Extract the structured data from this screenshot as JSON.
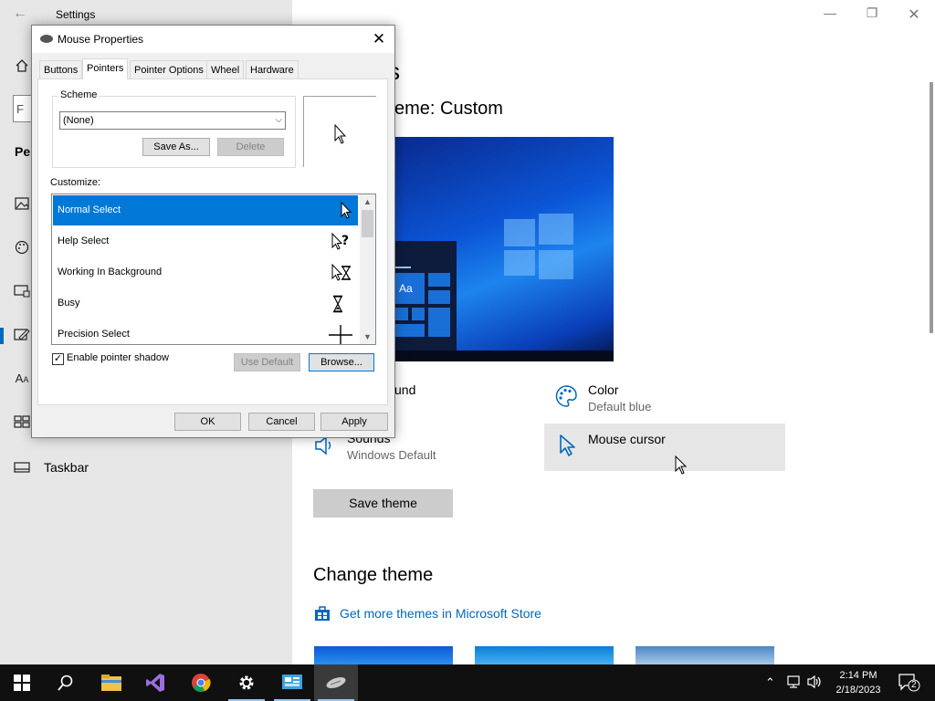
{
  "settings": {
    "title": "Settings",
    "back_icon": "back-arrow-icon",
    "window_controls": [
      "minimize-icon",
      "restore-icon",
      "close-icon"
    ],
    "nav": {
      "home_icon": "home-icon",
      "search_partial": "F",
      "section_partial": "Per",
      "items": [
        {
          "icon": "picture-icon"
        },
        {
          "icon": "palette-icon"
        },
        {
          "icon": "lock-screen-icon"
        },
        {
          "icon": "themes-icon",
          "active": true
        },
        {
          "icon": "font-icon"
        },
        {
          "icon": "start-icon"
        },
        {
          "icon": "taskbar-icon",
          "label": "Taskbar"
        }
      ]
    },
    "main": {
      "heading_partial": "s",
      "theme_heading": "eme: Custom",
      "preview_tile_label": "Aa",
      "background_partial": "und",
      "color": {
        "label": "Color",
        "value": "Default blue",
        "icon": "palette-icon"
      },
      "sounds": {
        "label": "Sounds",
        "value": "Windows Default",
        "icon": "speaker-icon"
      },
      "mouse_cursor": {
        "label": "Mouse cursor",
        "icon": "cursor-icon"
      },
      "save_theme": "Save theme",
      "change_theme": "Change theme",
      "store_link": "Get more themes in Microsoft Store",
      "store_icon": "store-icon"
    }
  },
  "dialog": {
    "title": "Mouse Properties",
    "title_icon": "mouse-icon",
    "tabs": [
      {
        "label": "Buttons"
      },
      {
        "label": "Pointers",
        "active": true
      },
      {
        "label": "Pointer Options"
      },
      {
        "label": "Wheel"
      },
      {
        "label": "Hardware"
      }
    ],
    "scheme": {
      "group_label": "Scheme",
      "selected": "(None)",
      "save_as": "Save As...",
      "delete": "Delete"
    },
    "customize_label": "Customize:",
    "pointer_list": [
      {
        "name": "Normal Select",
        "cursor": "arrow-cursor-icon",
        "selected": true
      },
      {
        "name": "Help Select",
        "cursor": "help-cursor-icon"
      },
      {
        "name": "Working In Background",
        "cursor": "working-cursor-icon"
      },
      {
        "name": "Busy",
        "cursor": "hourglass-icon"
      },
      {
        "name": "Precision Select",
        "cursor": "crosshair-icon"
      }
    ],
    "enable_shadow": {
      "label": "Enable pointer shadow",
      "checked": true
    },
    "use_default": "Use Default",
    "browse": "Browse...",
    "ok": "OK",
    "cancel": "Cancel",
    "apply": "Apply"
  },
  "taskbar": {
    "items": [
      {
        "icon": "windows-start-icon"
      },
      {
        "icon": "search-icon"
      },
      {
        "icon": "file-explorer-icon"
      },
      {
        "icon": "visual-studio-icon"
      },
      {
        "icon": "chrome-icon"
      },
      {
        "icon": "settings-gear-icon"
      },
      {
        "icon": "control-panel-icon"
      },
      {
        "icon": "mouse-icon"
      }
    ],
    "time": "2:14 PM",
    "date": "2/18/2023",
    "notification_count": "2"
  }
}
